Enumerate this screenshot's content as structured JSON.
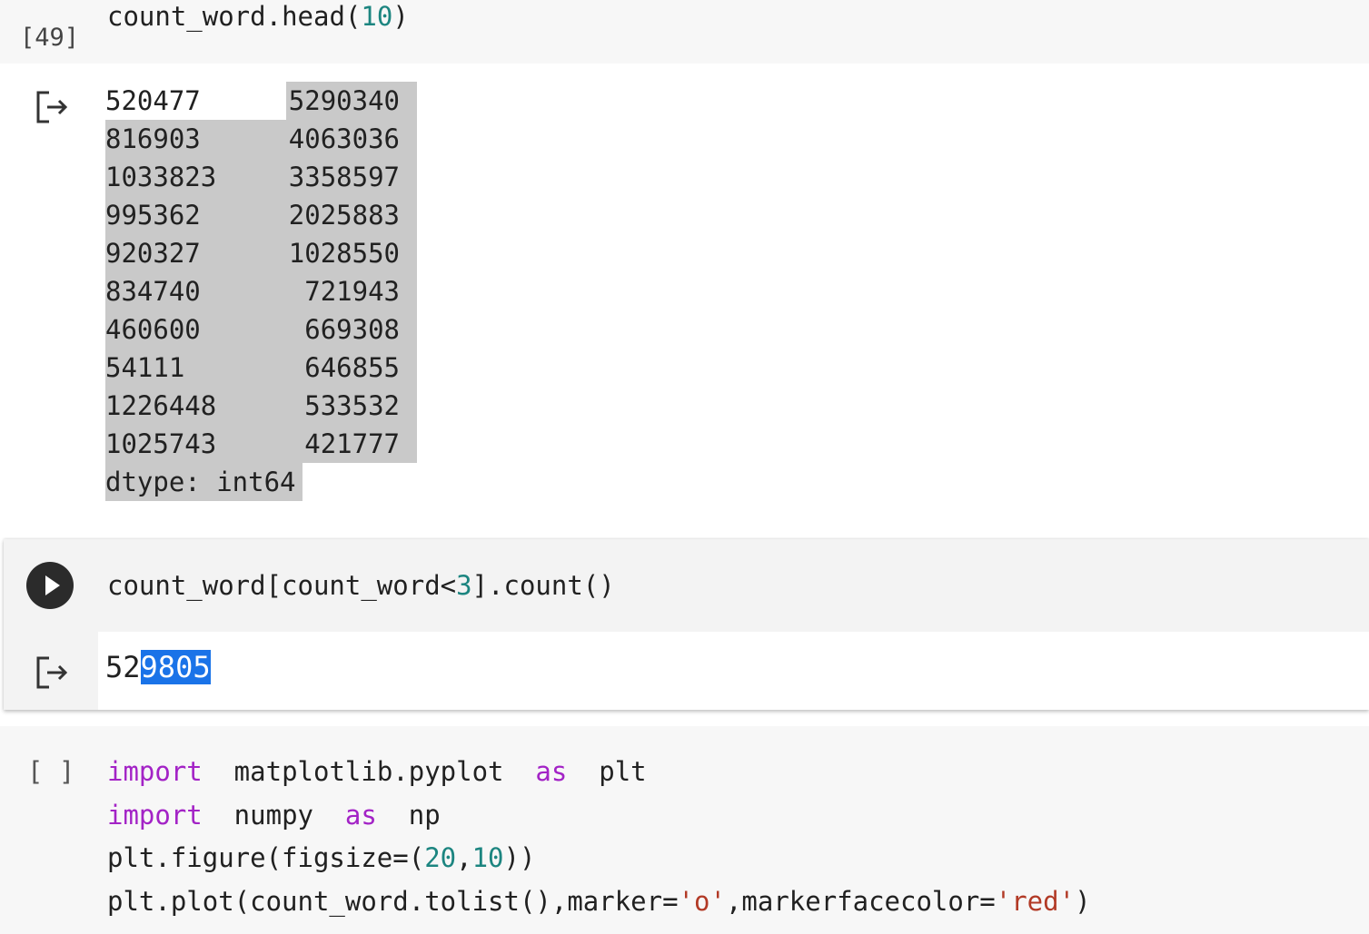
{
  "cells": [
    {
      "execution_count": "[49]",
      "code": {
        "obj": "count_word",
        "dot": ".",
        "method": "head",
        "open": "(",
        "arg": "10",
        "close": ")"
      },
      "output": {
        "rows": [
          {
            "index": "520477",
            "value": "5290340"
          },
          {
            "index": "816903",
            "value": "4063036"
          },
          {
            "index": "1033823",
            "value": "3358597"
          },
          {
            "index": "995362",
            "value": "2025883"
          },
          {
            "index": "920327",
            "value": "1028550"
          },
          {
            "index": "834740",
            "value": "721943"
          },
          {
            "index": "460600",
            "value": "669308"
          },
          {
            "index": "54111",
            "value": "646855"
          },
          {
            "index": "1226448",
            "value": "533532"
          },
          {
            "index": "1025743",
            "value": "421777"
          }
        ],
        "dtype_line": "dtype: int64"
      }
    },
    {
      "code": {
        "part1": "count_word[count_word<",
        "num": "3",
        "part2": "].count()"
      },
      "output": {
        "result_plain": "52",
        "result_selected": "9805"
      }
    },
    {
      "execution_count": "[ ]",
      "lines": {
        "l1_kw": "import",
        "l1_mod": "  matplotlib.pyplot  ",
        "l1_as": "as",
        "l1_alias": "  plt",
        "l2_kw": "import",
        "l2_mod": "  numpy  ",
        "l2_as": "as",
        "l2_alias": "  np",
        "l3_a": "plt.figure(figsize=(",
        "l3_n1": "20",
        "l3_b": ",",
        "l3_n2": "10",
        "l3_c": "))",
        "l4_a": "plt.plot(count_word.tolist(),marker=",
        "l4_s1": "'o'",
        "l4_b": ",markerfacecolor=",
        "l4_s2": "'red'",
        "l4_c": ")"
      }
    }
  ]
}
